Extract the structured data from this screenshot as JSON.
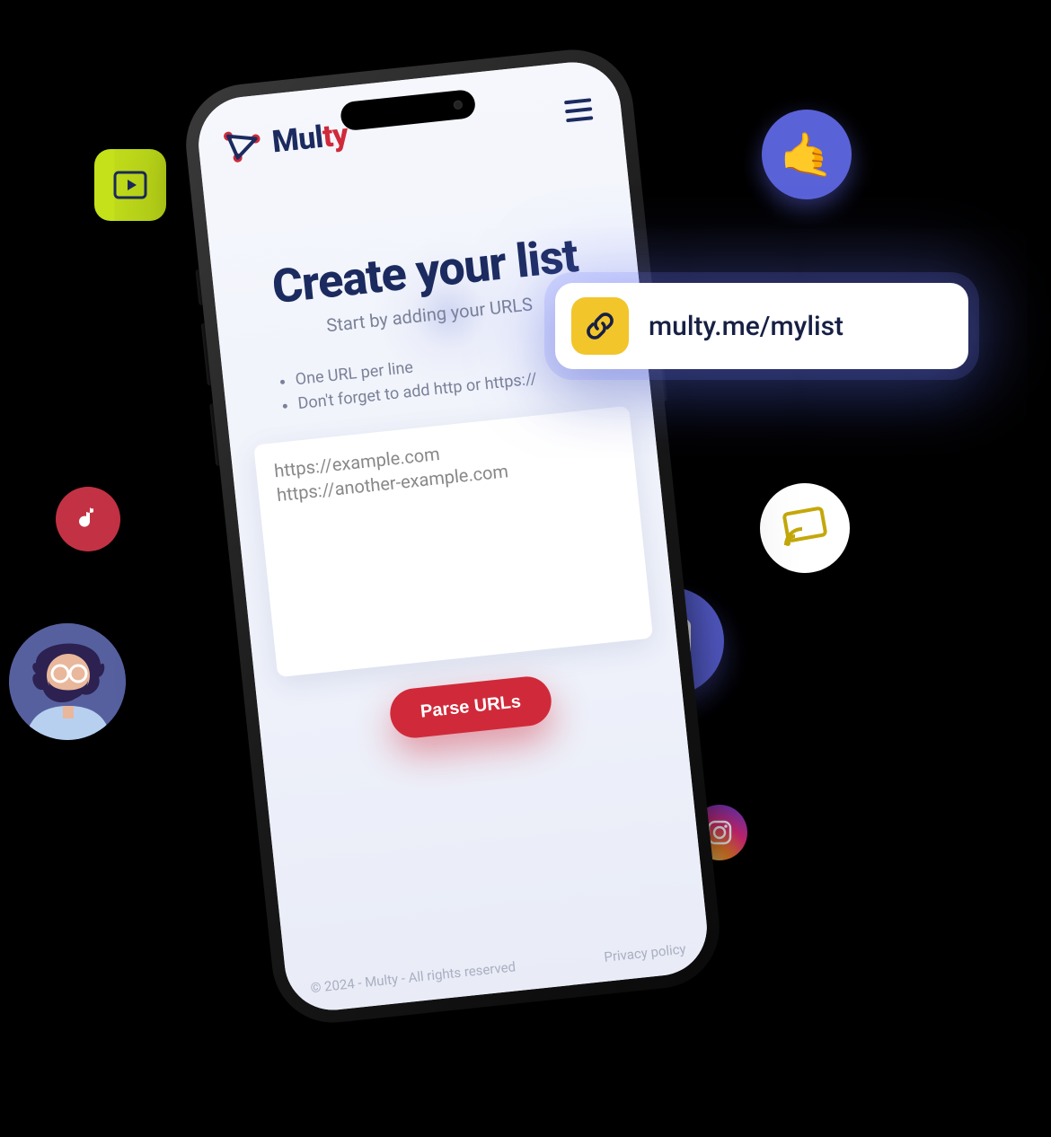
{
  "brand": {
    "name_part1": "Mul",
    "name_part2": "ty"
  },
  "hero": {
    "title": "Create your list",
    "subtitle": "Start by adding your URLS"
  },
  "tips": [
    "One URL per line",
    "Don't forget to add http or https://"
  ],
  "textarea": {
    "value": "https://example.com\nhttps://another-example.com"
  },
  "cta": {
    "parse_label": "Parse URLs"
  },
  "footer": {
    "copyright": "© 2024 - Multy - All rights reserved",
    "privacy_label": "Privacy policy"
  },
  "url_pill": {
    "text": "multy.me/mylist"
  },
  "icons": {
    "video": "play-rect-icon",
    "tiktok": "music-note-icon",
    "avatar": "avatar-illustration",
    "shaka": "call-me-emoji",
    "cast": "cast-icon",
    "doc": "documents-icon",
    "instagram": "instagram-icon",
    "link": "link-icon"
  },
  "colors": {
    "brand_navy": "#1c2b5f",
    "brand_red": "#d02a3a",
    "accent_indigo": "#5a62d8",
    "accent_lime": "#c4e11a",
    "accent_yellow": "#f2c52b"
  }
}
